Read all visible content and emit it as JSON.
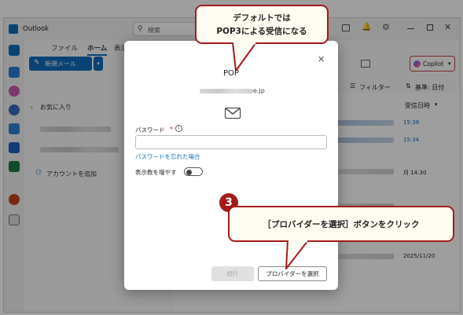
{
  "app": {
    "title": "Outlook",
    "search_placeholder": "検索"
  },
  "ribbon": {
    "tabs": [
      "ファイル",
      "ホーム",
      "表示"
    ],
    "new_mail_label": "新規メール",
    "copilot_label": "Copilot"
  },
  "folders": {
    "favorites_label": "お気に入り",
    "add_account_label": "アカウントを追加"
  },
  "list": {
    "filter_label": "フィルター",
    "sort_label": "基準: 日付",
    "received_col": "受信日時",
    "times": [
      "15:38",
      "15:34",
      "月 14:30",
      "2025/11/20"
    ]
  },
  "dialog": {
    "title": "POP",
    "email_suffix": "e.jp",
    "password_label": "パスワード",
    "required_mark": "*",
    "forgot_password_link": "パスワードを忘れた場合",
    "show_more_label": "表示数を増やす",
    "continue_button": "続行",
    "select_provider_button": "プロバイダーを選択"
  },
  "callouts": {
    "top_line1": "デフォルトでは",
    "top_line2": "POP3による受信になる",
    "step_number": "3",
    "bottom_text": "［プロバイダーを選択］ボタンをクリック"
  },
  "colors": {
    "accent": "#0f6cbd",
    "callout_border": "#a31a1a",
    "callout_fill": "#fffdf2"
  }
}
